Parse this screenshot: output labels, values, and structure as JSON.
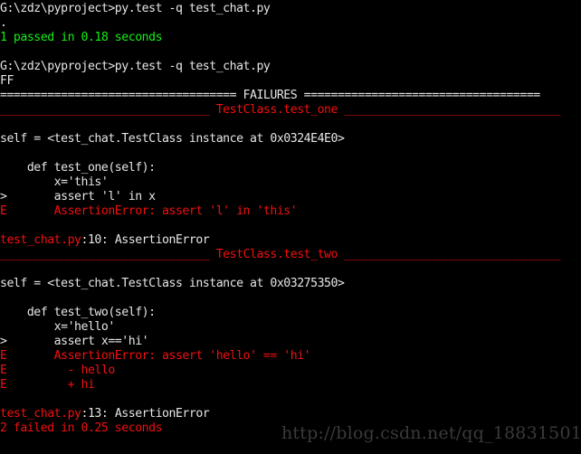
{
  "window": {
    "title": "Command Prompt - py.test output",
    "background_color": "#000000",
    "default_text_color": "#e6e6e6",
    "pass_color": "#14ef14",
    "fail_color": "#f01010",
    "watermark_color": "#3a3a3a",
    "columns": 80,
    "rows": 31
  },
  "watermark": {
    "text": "http://blog.csdn.net/qq_18831501"
  },
  "console": {
    "lines": [
      {
        "id": "prompt-1",
        "text": "G:\\zdz\\pyproject>py.test -q test_chat.py",
        "color": "white"
      },
      {
        "id": "progress-dot",
        "text": ".",
        "color": "white"
      },
      {
        "id": "summary-pass",
        "text": "1 passed in 0.18 seconds",
        "color": "green"
      },
      {
        "id": "blank-1",
        "text": "",
        "color": "blank"
      },
      {
        "id": "prompt-2",
        "text": "G:\\zdz\\pyproject>py.test -q test_chat.py",
        "color": "white"
      },
      {
        "id": "progress-ff",
        "text": "FF",
        "color": "white"
      },
      {
        "id": "failures-banner",
        "text": "=================================== FAILURES ===================================",
        "color": "white"
      },
      {
        "id": "sep-test-one",
        "text": "_______________________________ TestClass.test_one ________________________________",
        "color": "red"
      },
      {
        "id": "blank-2",
        "text": "",
        "color": "blank"
      },
      {
        "id": "self-one",
        "text": "self = <test_chat.TestClass instance at 0x0324E4E0>",
        "color": "white"
      },
      {
        "id": "blank-3",
        "text": "",
        "color": "blank"
      },
      {
        "id": "code-one-def",
        "text": "    def test_one(self):",
        "color": "white"
      },
      {
        "id": "code-one-assign",
        "text": "        x='this'",
        "color": "white"
      },
      {
        "id": "code-one-assert",
        "text": ">       assert 'l' in x",
        "color": "white"
      },
      {
        "id": "err-one",
        "text": "E       AssertionError: assert 'l' in 'this'",
        "color": "red"
      },
      {
        "id": "blank-4",
        "text": "",
        "color": "blank"
      },
      {
        "id": "loc-one",
        "text": "test_chat.py:10: AssertionError",
        "color": "split",
        "red_part": "test_chat.py",
        "white_part": ":10: AssertionError"
      },
      {
        "id": "sep-test-two",
        "text": "_______________________________ TestClass.test_two ________________________________",
        "color": "red"
      },
      {
        "id": "blank-5",
        "text": "",
        "color": "blank"
      },
      {
        "id": "self-two",
        "text": "self = <test_chat.TestClass instance at 0x03275350>",
        "color": "white"
      },
      {
        "id": "blank-6",
        "text": "",
        "color": "blank"
      },
      {
        "id": "code-two-def",
        "text": "    def test_two(self):",
        "color": "white"
      },
      {
        "id": "code-two-assign",
        "text": "        x='hello'",
        "color": "white"
      },
      {
        "id": "code-two-assert",
        "text": ">       assert x=='hi'",
        "color": "white"
      },
      {
        "id": "err-two",
        "text": "E       AssertionError: assert 'hello' == 'hi'",
        "color": "red"
      },
      {
        "id": "err-two-minus",
        "text": "E         - hello",
        "color": "red"
      },
      {
        "id": "err-two-plus",
        "text": "E         + hi",
        "color": "red"
      },
      {
        "id": "blank-7",
        "text": "",
        "color": "blank"
      },
      {
        "id": "loc-two",
        "text": "test_chat.py:13: AssertionError",
        "color": "split",
        "red_part": "test_chat.py",
        "white_part": ":13: AssertionError"
      },
      {
        "id": "summary-fail",
        "text": "2 failed in 0.25 seconds",
        "color": "red"
      }
    ]
  }
}
